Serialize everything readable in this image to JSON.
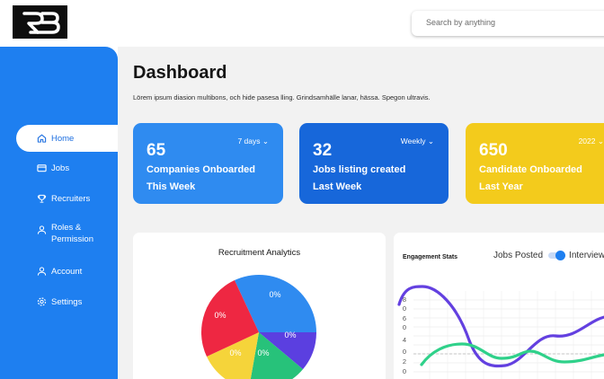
{
  "logo": {
    "text": "RB"
  },
  "search": {
    "placeholder": "Search by anything"
  },
  "sidebar": {
    "items": [
      {
        "label": "Home",
        "icon": "home-icon",
        "active": true
      },
      {
        "label": "Jobs",
        "icon": "card-icon"
      },
      {
        "label": "Recruiters",
        "icon": "trophy-icon"
      },
      {
        "label": "Roles & Permission",
        "icon": "user-icon"
      },
      {
        "label": "Account",
        "icon": "user-icon"
      },
      {
        "label": "Settings",
        "icon": "gear-icon"
      }
    ]
  },
  "page": {
    "title": "Dashboard",
    "subtitle": "Lörem ipsum diasion multibons, och hide pasesa lling. Grindsamhälle lanar, hässa. Spegon ultravis."
  },
  "cards": [
    {
      "value": "65",
      "period": "7 days",
      "line1": "Companies Onboarded",
      "line2": "This Week",
      "color": "#2f8bf0"
    },
    {
      "value": "32",
      "period": "Weekly",
      "line1": "Jobs listing created",
      "line2": "Last Week",
      "color": "#1767da"
    },
    {
      "value": "650",
      "period": "2022",
      "line1": "Candidate Onboarded",
      "line2": "Last Year",
      "color": "#f3cb1c"
    }
  ],
  "recruitment": {
    "title": "Recruitment Analytics",
    "slices": [
      {
        "label": "0%",
        "color": "#2f8bf0"
      },
      {
        "label": "0%",
        "color": "#5b3fe0"
      },
      {
        "label": "0%",
        "color": "#27c27a"
      },
      {
        "label": "0%",
        "color": "#f5d43a"
      },
      {
        "label": "0%",
        "color": "#ee2742"
      }
    ]
  },
  "engagement": {
    "title": "Engagement Stats",
    "legend_jobs": "Jobs Posted",
    "legend_interviews": "Interviews",
    "yticks": [
      "8",
      "6",
      "4",
      "2",
      "0"
    ],
    "colors": {
      "jobs": "#6340e0",
      "interviews": "#2fd18a"
    }
  }
}
